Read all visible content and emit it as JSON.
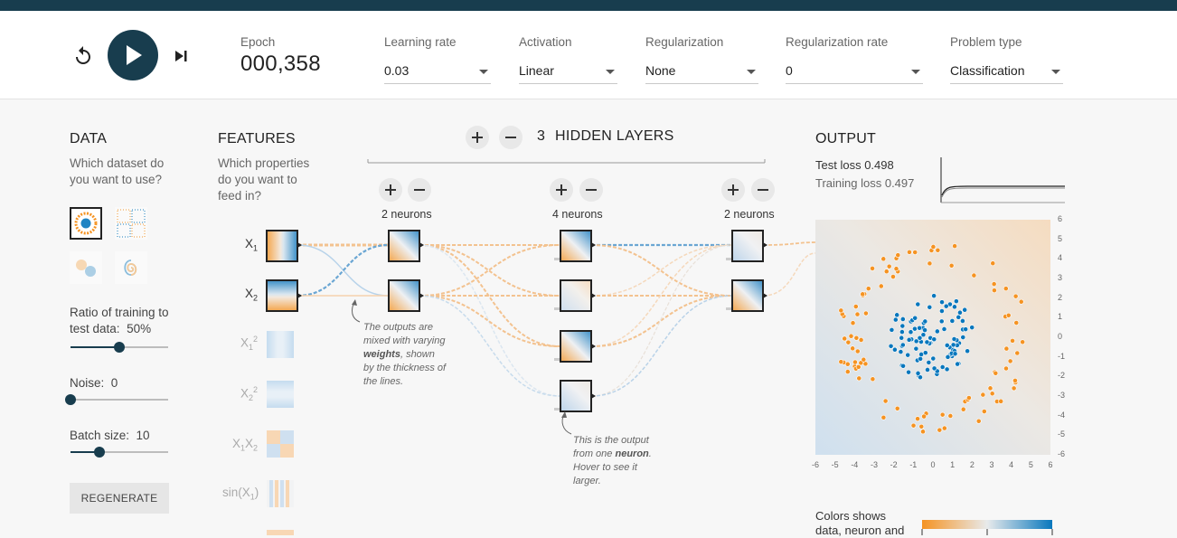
{
  "header": {
    "epoch_label": "Epoch",
    "epoch_value": "000,358",
    "learning_rate": {
      "label": "Learning rate",
      "value": "0.03"
    },
    "activation": {
      "label": "Activation",
      "value": "Linear"
    },
    "regularization": {
      "label": "Regularization",
      "value": "None"
    },
    "regularization_rate": {
      "label": "Regularization rate",
      "value": "0"
    },
    "problem_type": {
      "label": "Problem type",
      "value": "Classification"
    }
  },
  "data_panel": {
    "title": "DATA",
    "question": "Which dataset do you want to use?",
    "ratio_label": "Ratio of training to test data:",
    "ratio_value": "50%",
    "ratio_fraction": 0.5,
    "noise_label": "Noise:",
    "noise_value": "0",
    "noise_fraction": 0,
    "batch_label": "Batch size:",
    "batch_value": "10",
    "batch_fraction": 0.3,
    "regenerate_label": "REGENERATE"
  },
  "features_panel": {
    "title": "FEATURES",
    "question": "Which properties do you want to feed in?",
    "features": [
      "X1",
      "X2",
      "X1²",
      "X2²",
      "X1X2",
      "sin(X1)"
    ]
  },
  "network": {
    "hidden_layers_count": "3",
    "hidden_layers_label": "HIDDEN LAYERS",
    "layers": [
      {
        "neurons_label": "2 neurons"
      },
      {
        "neurons_label": "4 neurons"
      },
      {
        "neurons_label": "2 neurons"
      }
    ],
    "note_weights": [
      "The outputs are",
      "mixed with varying",
      "weights",
      ", shown",
      "by the thickness of",
      "the lines."
    ],
    "note_neuron": [
      "This is the output",
      "from one",
      "neuron",
      ".",
      "Hover to see it",
      "larger."
    ]
  },
  "output_panel": {
    "title": "OUTPUT",
    "test_loss_label": "Test loss",
    "test_loss_value": "0.498",
    "training_loss_label": "Training loss",
    "training_loss_value": "0.497",
    "x_ticks": [
      "-6",
      "-5",
      "-4",
      "-3",
      "-2",
      "-1",
      "0",
      "1",
      "2",
      "3",
      "4",
      "5",
      "6"
    ],
    "y_ticks": [
      "6",
      "5",
      "4",
      "3",
      "2",
      "1",
      "0",
      "-1",
      "-2",
      "-3",
      "-4",
      "-5",
      "-6"
    ],
    "legend_text": [
      "Colors shows",
      "data, neuron and"
    ]
  },
  "colors": {
    "orange": "#f59322",
    "blue": "#0877bd",
    "dark": "#183d4e"
  },
  "icons": [
    "reset-icon",
    "play-icon",
    "step-icon",
    "plus-icon",
    "minus-icon"
  ]
}
